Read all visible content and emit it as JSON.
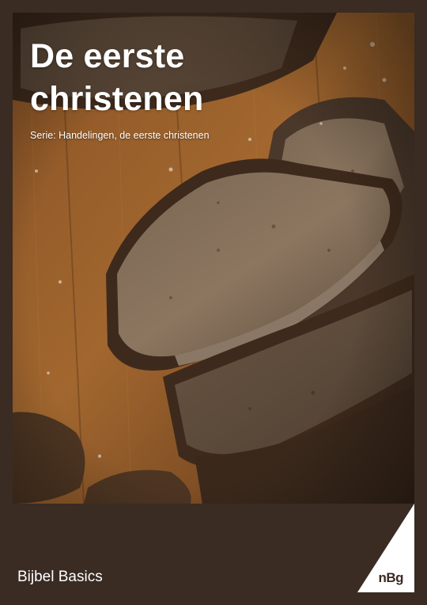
{
  "cover": {
    "title_line1": "De eerste",
    "title_line2": "christenen",
    "subtitle": "Serie: Handelingen, de eerste christenen",
    "footer_label": "Bijbel Basics",
    "logo_text": "nBg"
  },
  "image": {
    "description_icon": "bread-photo-icon"
  },
  "colors": {
    "frame": "#3a2b23",
    "text": "#ffffff",
    "wood": "#8a5326",
    "bread_crumb": "#6b5a48",
    "bread_crust": "#3e2a1c"
  }
}
